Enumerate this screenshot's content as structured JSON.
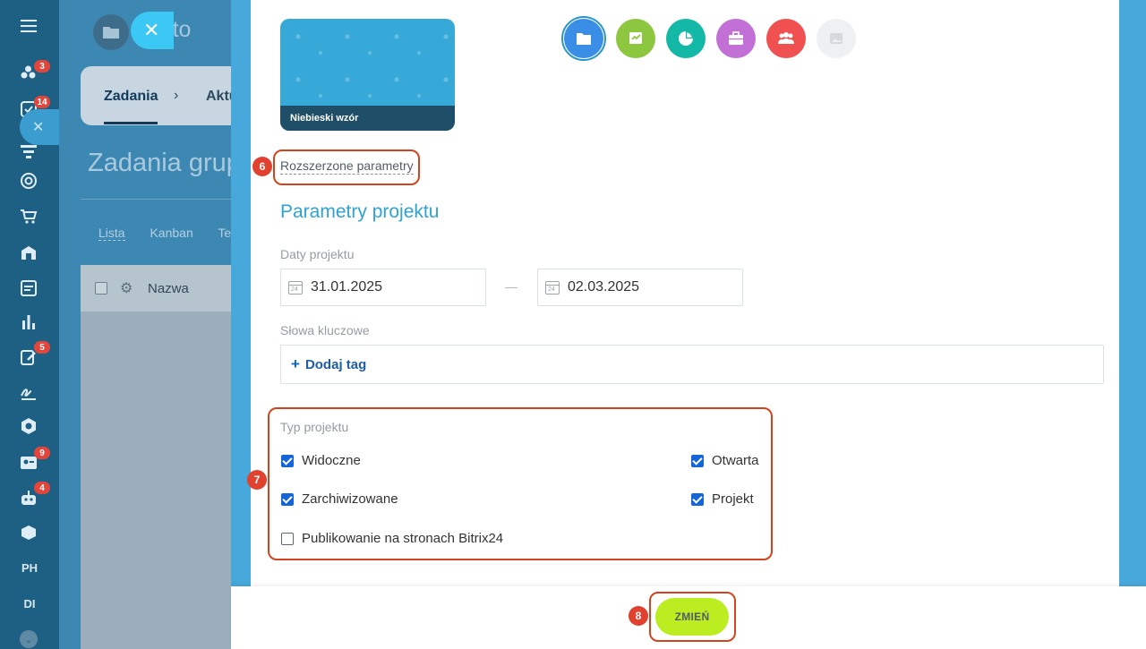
{
  "nav": {
    "badges": {
      "chat": "3",
      "tasks": "14",
      "crm": "5",
      "contacts": "9",
      "bot": "4"
    },
    "text_items": [
      "PH",
      "DI"
    ]
  },
  "background_page": {
    "app_title": "Auto",
    "tabs": {
      "active": "Zadania",
      "next": "Aktu"
    },
    "heading": "Zadania grup",
    "views": [
      "Lista",
      "Kanban",
      "Te"
    ],
    "table_column": "Nazwa"
  },
  "slider": {
    "cover": {
      "label": "Niebieski wzór"
    },
    "icons": [
      {
        "name": "folder-icon",
        "color": "#3a8ee6"
      },
      {
        "name": "presentation-icon",
        "color": "#8dc63f"
      },
      {
        "name": "pie-chart-icon",
        "color": "#14b8a6"
      },
      {
        "name": "briefcase-icon",
        "color": "#c26fd6"
      },
      {
        "name": "team-icon",
        "color": "#f0504f"
      },
      {
        "name": "image-icon",
        "color": "#eef0f2"
      }
    ],
    "advanced_params_link": "Rozszerzone parametry",
    "section_title": "Parametry projektu",
    "dates": {
      "label": "Daty projektu",
      "start": "31.01.2025",
      "end": "02.03.2025",
      "calendar_day": "24"
    },
    "keywords": {
      "label": "Słowa kluczowe",
      "add_tag_plus": "+",
      "add_tag": "Dodaj tag"
    },
    "project_type": {
      "label": "Typ projektu",
      "options": [
        {
          "label": "Widoczne",
          "checked": true
        },
        {
          "label": "Otwarta",
          "checked": true
        },
        {
          "label": "Zarchiwizowane",
          "checked": true
        },
        {
          "label": "Projekt",
          "checked": true
        },
        {
          "label": "Publikowanie na stronach Bitrix24",
          "checked": false
        }
      ]
    },
    "steps": {
      "advanced": "6",
      "type": "7",
      "save": "8"
    },
    "save_button": "ZMIEŃ"
  },
  "colors": {
    "accent": "#2fa2d4",
    "save_button": "#bbed21",
    "callout": "#d2441f",
    "checkbox": "#1565d8"
  }
}
